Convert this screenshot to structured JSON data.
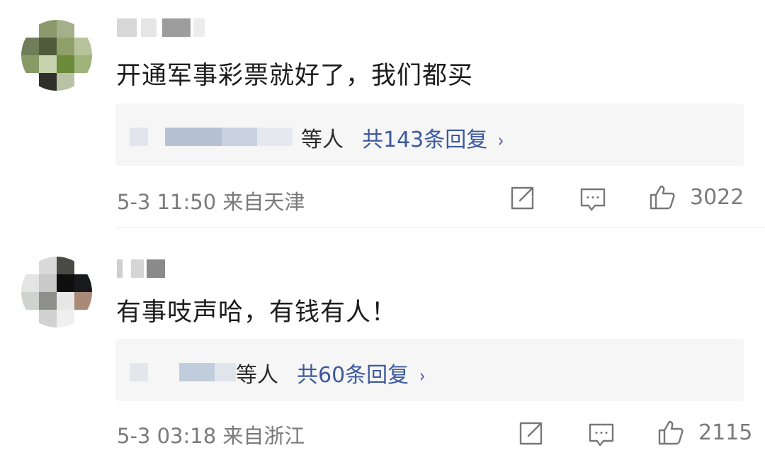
{
  "comments": [
    {
      "text": "开通军事彩票就好了，我们都买",
      "reply_suffix": "等人",
      "reply_link": "共143条回复",
      "chevron": "›",
      "meta": "5-3 11:50 来自天津",
      "like_count": "3022",
      "icons": [
        "share-icon",
        "comment-icon",
        "thumbs-up-icon"
      ]
    },
    {
      "text": "有事吱声哈，有钱有人！",
      "reply_suffix": "等人",
      "reply_link": "共60条回复",
      "chevron": "›",
      "meta": "5-3 03:18 来自浙江",
      "like_count": "2115",
      "icons": [
        "share-icon",
        "comment-icon",
        "thumbs-up-icon"
      ]
    }
  ],
  "colors": {
    "link": "#3d5a9e",
    "meta": "#7a7a7a",
    "reply_bg": "#f6f6f6",
    "divider": "#e8e8e8"
  }
}
